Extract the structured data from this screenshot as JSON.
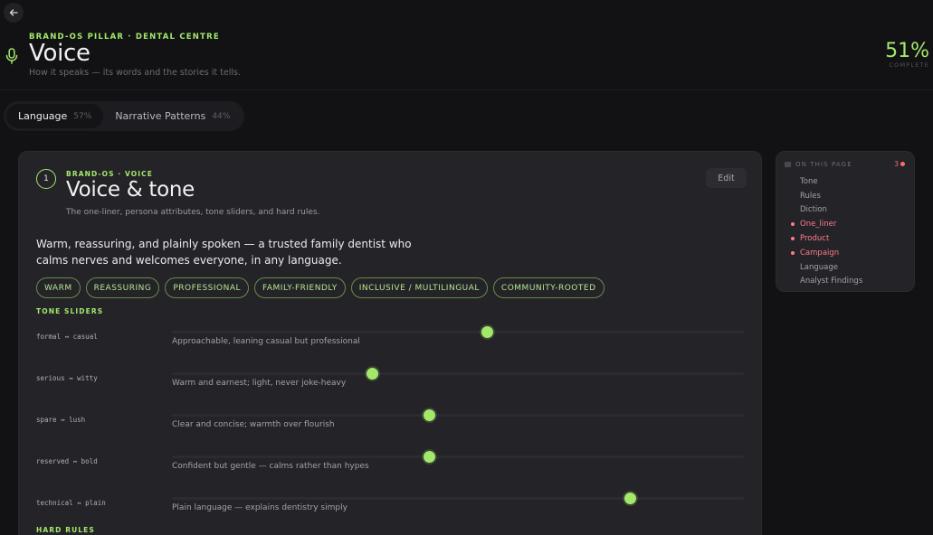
{
  "header": {
    "eyebrow": "BRAND-OS PILLAR · DENTAL CENTRE",
    "title": "Voice",
    "subtitle": "How it speaks — its words and the stories it tells.",
    "progress_value": "51%",
    "progress_label": "COMPLETE"
  },
  "tabs": [
    {
      "label": "Language",
      "pct": "57%",
      "active": true
    },
    {
      "label": "Narrative Patterns",
      "pct": "44%",
      "active": false
    }
  ],
  "card": {
    "number": "1",
    "eyebrow": "BRAND-OS · VOICE",
    "title": "Voice & tone",
    "subtitle": "The one-liner, persona attributes, tone sliders, and hard rules.",
    "edit_label": "Edit",
    "one_liner": "Warm, reassuring, and plainly spoken — a trusted family dentist who calms nerves and welcomes everyone, in any language.",
    "chips": [
      "WARM",
      "REASSURING",
      "PROFESSIONAL",
      "FAMILY-FRIENDLY",
      "INCLUSIVE / MULTILINGUAL",
      "COMMUNITY-ROOTED"
    ],
    "tone_sliders_label": "TONE SLIDERS",
    "sliders": [
      {
        "name": "formal ↔ casual",
        "description": "Approachable, leaning casual but professional",
        "value": 0.55
      },
      {
        "name": "serious ↔ witty",
        "description": "Warm and earnest; light, never joke-heavy",
        "value": 0.35
      },
      {
        "name": "spare ↔ lush",
        "description": "Clear and concise; warmth over flourish",
        "value": 0.45
      },
      {
        "name": "reserved ↔ bold",
        "description": "Confident but gentle — calms rather than hypes",
        "value": 0.45
      },
      {
        "name": "technical ↔ plain",
        "description": "Plain language — explains dentistry simply",
        "value": 0.8
      }
    ],
    "hard_rules_label": "HARD RULES"
  },
  "toc": {
    "heading": "ON THIS PAGE",
    "count": "3",
    "items": [
      {
        "label": "Tone",
        "flagged": false
      },
      {
        "label": "Rules",
        "flagged": false
      },
      {
        "label": "Diction",
        "flagged": false
      },
      {
        "label": "One_liner",
        "flagged": true
      },
      {
        "label": "Product",
        "flagged": true
      },
      {
        "label": "Campaign",
        "flagged": true
      },
      {
        "label": "Language",
        "flagged": false
      },
      {
        "label": "Analyst Findings",
        "flagged": false
      }
    ]
  },
  "colors": {
    "accent": "#a4e86a",
    "flag": "#ff7b88",
    "background": "#121214",
    "card": "#232328"
  }
}
